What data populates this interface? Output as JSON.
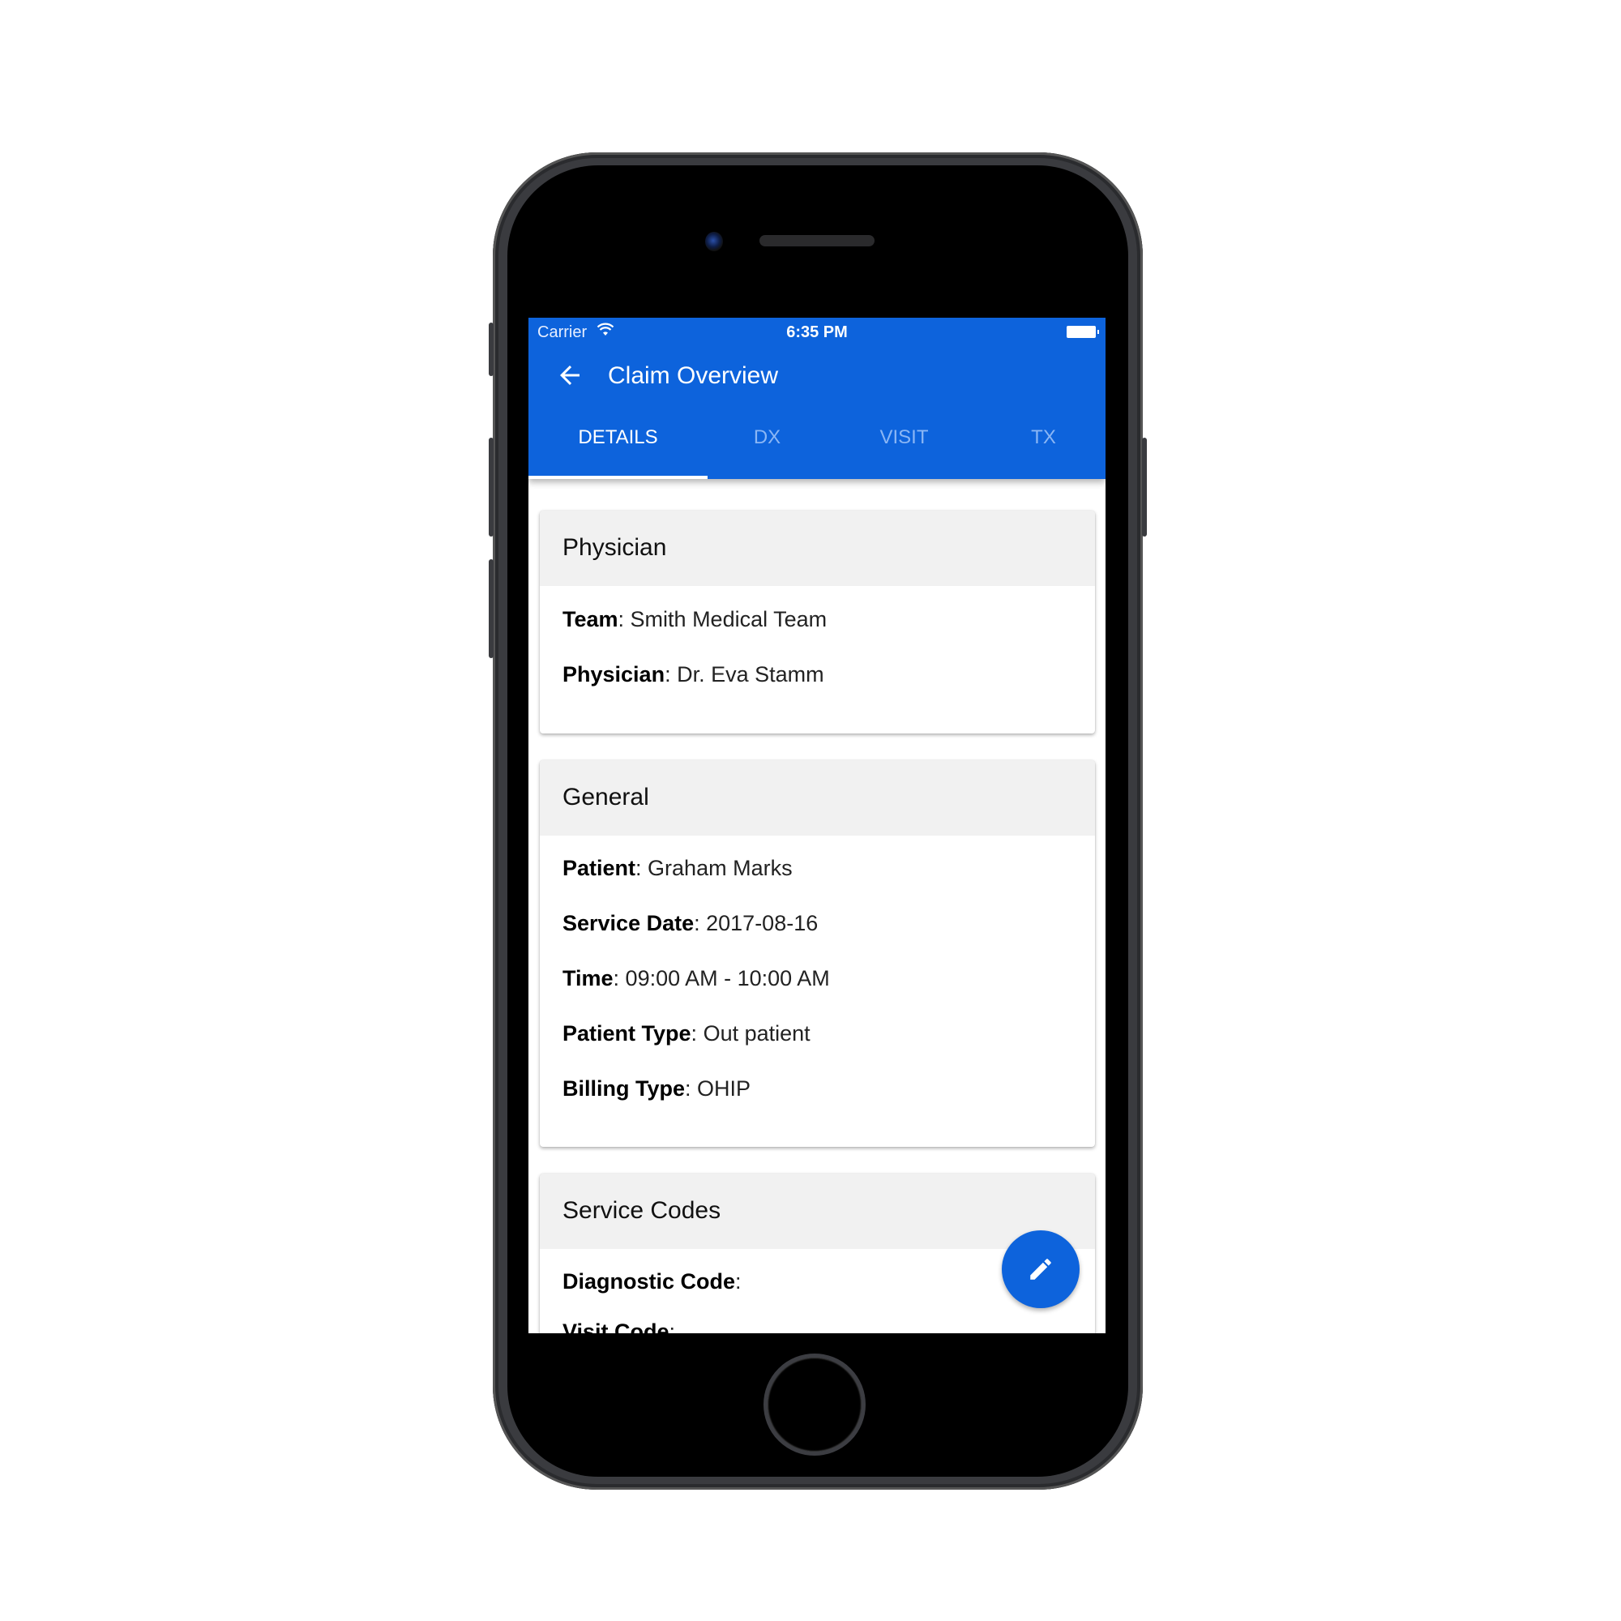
{
  "status_bar": {
    "carrier": "Carrier",
    "time": "6:35 PM",
    "wifi_icon": "wifi-icon",
    "battery_icon": "battery-icon"
  },
  "app_bar": {
    "back_icon": "arrow-left-icon",
    "title": "Claim Overview"
  },
  "tabs": [
    {
      "label": "DETAILS",
      "active": true
    },
    {
      "label": "DX",
      "active": false
    },
    {
      "label": "VISIT",
      "active": false
    },
    {
      "label": "TX",
      "active": false
    }
  ],
  "cards": [
    {
      "title": "Physician",
      "rows": [
        {
          "label": "Team",
          "value": "Smith Medical Team"
        },
        {
          "label": "Physician",
          "value": "Dr. Eva Stamm"
        }
      ]
    },
    {
      "title": "General",
      "rows": [
        {
          "label": "Patient",
          "value": "Graham Marks"
        },
        {
          "label": "Service Date",
          "value": "2017-08-16"
        },
        {
          "label": "Time",
          "value": "09:00 AM - 10:00 AM"
        },
        {
          "label": "Patient Type",
          "value": "Out patient"
        },
        {
          "label": "Billing Type",
          "value": "OHIP"
        }
      ]
    },
    {
      "title": "Service Codes",
      "rows": [
        {
          "label": "Diagnostic Code",
          "value": ""
        },
        {
          "label": "Visit Code",
          "value": ""
        }
      ]
    }
  ],
  "fab": {
    "icon": "pencil-icon"
  },
  "colors": {
    "primary": "#0d63dc",
    "card_header_bg": "#f1f1f1",
    "inactive_tab": "#8ab6f5"
  }
}
